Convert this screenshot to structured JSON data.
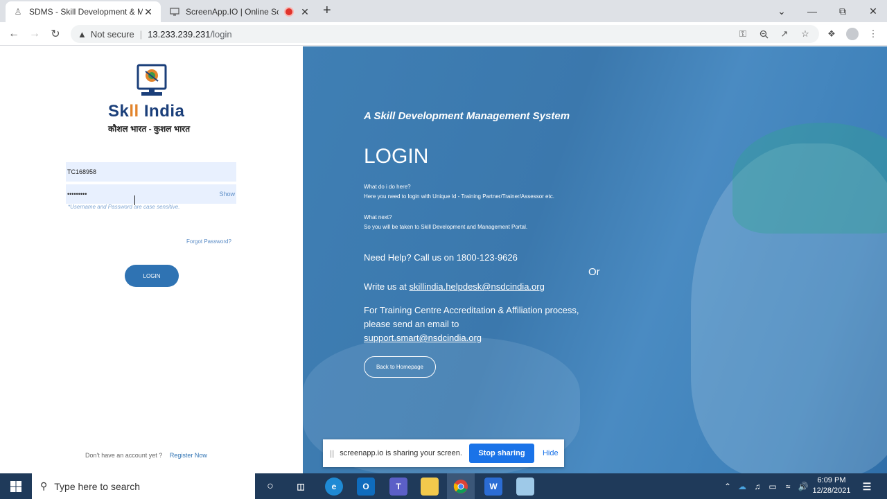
{
  "browser": {
    "tabs": [
      {
        "title": "SDMS - Skill Development & Ma"
      },
      {
        "title": "ScreenApp.IO | Online Screen"
      }
    ],
    "new_tab": "+",
    "address": {
      "warning": "Not secure",
      "separator": "|",
      "host": "13.233.239.231",
      "path": "/login"
    }
  },
  "left_panel": {
    "brand_skill": "Sk",
    "brand_ll": "ll",
    "brand_india": " India",
    "tagline": "कौशल भारत - कुशल भारत",
    "username_value": "TC168958",
    "password_value": "•••••••••",
    "show_label": "Show",
    "hint": "*Username and Password are case sensitive.",
    "forgot_password": "Forgot Password?",
    "login_button": "LOGIN",
    "no_account": "Don't have an account yet ?",
    "register": "Register Now"
  },
  "right_panel": {
    "subtitle": "A Skill Development Management System",
    "title": "LOGIN",
    "q1": "What do i do here?",
    "a1": "Here you need to login with Unique Id - Training Partner/Trainer/Assessor etc.",
    "q2": "What next?",
    "a2": "So you will be taken to Skill Development and Management Portal.",
    "help": "Need Help? Call us on 1800-123-9626",
    "or": "Or",
    "write_prefix": "Write us at ",
    "write_email": "skillindia.helpdesk@nsdcindia.org",
    "accreditation_line1": "For Training Centre Accreditation & Affiliation process,",
    "accreditation_line2": "please send an email to",
    "accreditation_email": "support.smart@nsdcindia.org",
    "back_button": "Back to Homepage"
  },
  "share_bar": {
    "grip": "||",
    "message": "screenapp.io is sharing your screen.",
    "stop": "Stop sharing",
    "hide": "Hide"
  },
  "taskbar": {
    "search_placeholder": "Type here to search",
    "time": "6:09 PM",
    "date": "12/28/2021"
  }
}
